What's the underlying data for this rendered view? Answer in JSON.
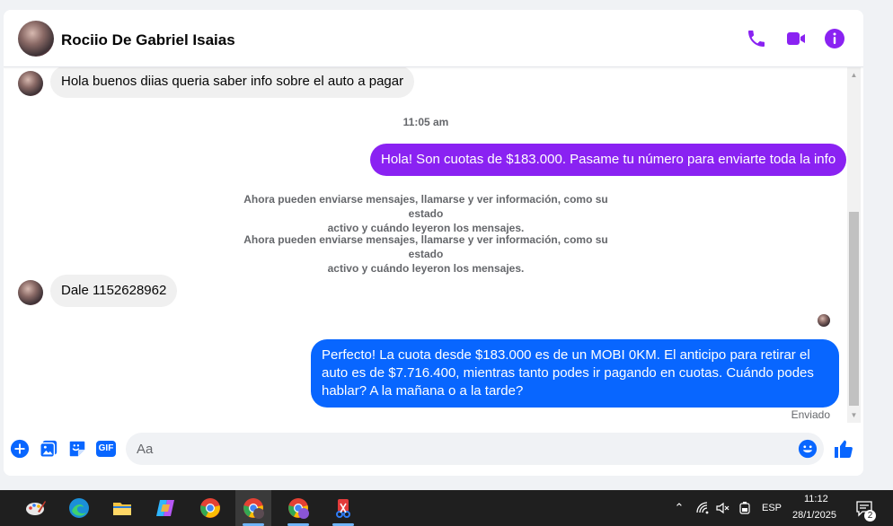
{
  "header": {
    "contact_name": "Rociio De Gabriel Isaias"
  },
  "messages": {
    "m1": "Hola buenos diias queria saber info sobre el auto a pagar",
    "timestamp": "11:05 am",
    "m2": "Hola! Son cuotas de $183.000. Pasame tu número para enviarte toda la info",
    "sys1_line1": "Ahora pueden enviarse mensajes, llamarse y ver información, como su estado",
    "sys1_line2": "activo y cuándo leyeron los mensajes.",
    "sys2_line1": "Ahora pueden enviarse mensajes, llamarse y ver información, como su estado",
    "sys2_line2": "activo y cuándo leyeron los mensajes.",
    "m3": "Dale 1152628962",
    "m4_line1": "Perfecto! La cuota desde $183.000 es de un MOBI 0KM. El anticipo para retirar el",
    "m4_line2": "auto es de $7.716.400, mientras tanto podes ir pagando en cuotas. Cuándo podes",
    "m4_line3": "hablar? A la mañana o a la tarde?",
    "status": "Enviado"
  },
  "composer": {
    "placeholder": "Aa",
    "gif_label": "GIF"
  },
  "taskbar": {
    "language": "ESP",
    "time": "11:12",
    "date": "28/1/2025",
    "notification_count": "2"
  },
  "colors": {
    "accent_purple": "#8a22f2",
    "outgoing_blue": "#0866ff",
    "icon_blue": "#0866ff"
  }
}
